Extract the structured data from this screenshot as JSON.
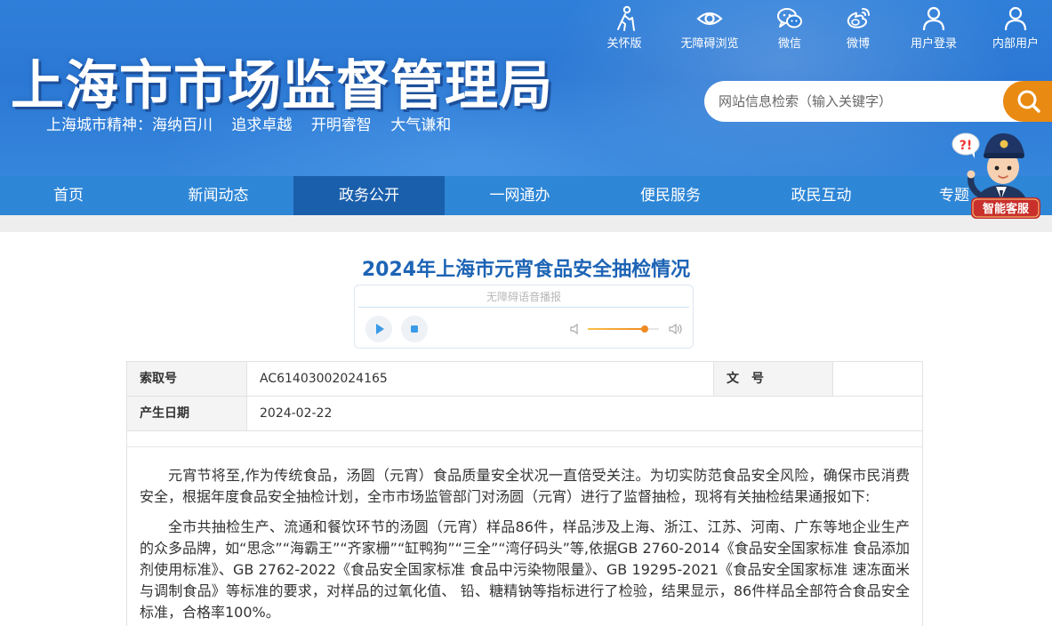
{
  "header": {
    "site_title": "上海市市场监督管理局",
    "motto": [
      "上海城市精神：海纳百川",
      "追求卓越",
      "开明睿智",
      "大气谦和"
    ],
    "toplinks": [
      {
        "label": "关怀版",
        "icon": "elderly-care-icon"
      },
      {
        "label": "无障碍浏览",
        "icon": "eye-icon"
      },
      {
        "label": "微信",
        "icon": "wechat-icon"
      },
      {
        "label": "微博",
        "icon": "weibo-icon"
      },
      {
        "label": "用户登录",
        "icon": "user-icon"
      },
      {
        "label": "内部用户",
        "icon": "internal-user-icon"
      }
    ],
    "search_placeholder": "网站信息检索（输入关键字）",
    "search_icon": "search-icon"
  },
  "nav": {
    "items": [
      "首页",
      "新闻动态",
      "政务公开",
      "一网通办",
      "便民服务",
      "政民互动",
      "专题"
    ],
    "active_index": 2
  },
  "assistant": {
    "label": "智能客服",
    "icon": "police-mascot-icon",
    "bubble": "?!"
  },
  "article": {
    "title": "2024年上海市元宵食品安全抽检情况",
    "player": {
      "title": "无障碍语音播报",
      "play_icon": "play-icon",
      "stop_icon": "stop-icon",
      "volume_min_icon": "volume-low-icon",
      "volume_max_icon": "volume-high-icon",
      "volume_level": 0.8
    },
    "meta": {
      "index_no_label": "索取号",
      "index_no_value": "AC61403002024165",
      "doc_no_label": "文　号",
      "doc_no_value": "",
      "date_label": "产生日期",
      "date_value": "2024-02-22"
    },
    "paragraphs": [
      "元宵节将至,作为传统食品，汤圆（元宵）食品质量安全状况一直倍受关注。为切实防范食品安全风险，确保市民消费安全，根据年度食品安全抽检计划，全市市场监管部门对汤圆（元宵）进行了监督抽检，现将有关抽检结果通报如下:",
      "全市共抽检生产、流通和餐饮环节的汤圆（元宵）样品86件，样品涉及上海、浙江、江苏、河南、广东等地企业生产的众多品牌，如“思念”“海霸王”“齐家栅”“缸鸭狗”“三全”“湾仔码头”等,依据GB 2760-2014《食品安全国家标准 食品添加剂使用标准》、GB 2762-2022《食品安全国家标准 食品中污染物限量》、GB 19295-2021《食品安全国家标准 速冻面米与调制食品》等标准的要求，对样品的过氧化值、 铅、糖精钠等指标进行了检验，结果显示，86件样品全部符合食品安全标准，合格率100%。"
    ]
  },
  "colors": {
    "header_blue": "#2b78d4",
    "nav_blue": "#2e86d6",
    "nav_active": "#1a5fab",
    "search_orange": "#e98a12",
    "title_blue": "#1d64b5"
  }
}
